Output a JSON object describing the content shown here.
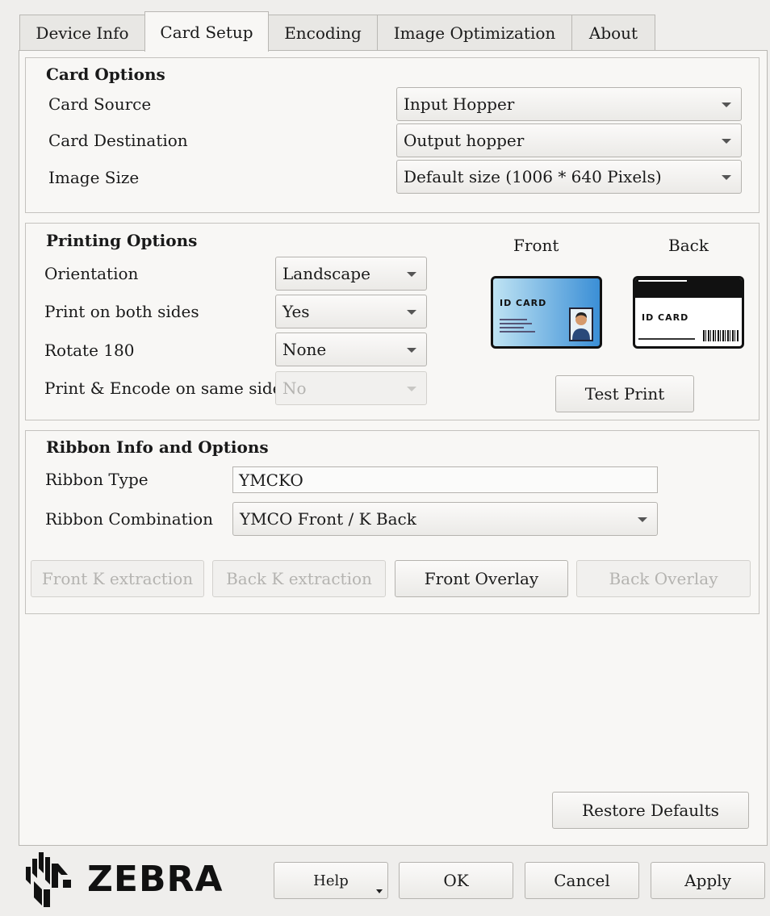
{
  "tabs": [
    {
      "label": "Device Info"
    },
    {
      "label": "Card Setup"
    },
    {
      "label": "Encoding"
    },
    {
      "label": "Image Optimization"
    },
    {
      "label": "About"
    }
  ],
  "card_options": {
    "title": "Card Options",
    "source_label": "Card Source",
    "source_value": "Input Hopper",
    "destination_label": "Card Destination",
    "destination_value": "Output hopper",
    "image_size_label": "Image Size",
    "image_size_value": "Default size (1006 * 640 Pixels)"
  },
  "printing_options": {
    "title": "Printing Options",
    "orientation_label": "Orientation",
    "orientation_value": "Landscape",
    "both_sides_label": "Print on both sides",
    "both_sides_value": "Yes",
    "rotate_label": "Rotate 180",
    "rotate_value": "None",
    "same_side_label": "Print & Encode on same side",
    "same_side_value": "No",
    "front_label": "Front",
    "back_label": "Back",
    "front_card_text": "ID CARD",
    "back_card_text": "ID CARD",
    "test_print_label": "Test Print"
  },
  "ribbon": {
    "title": "Ribbon Info and Options",
    "type_label": "Ribbon Type",
    "type_value": "YMCKO",
    "combination_label": "Ribbon Combination",
    "combination_value": "YMCO Front / K Back",
    "front_k_label": "Front K extraction",
    "back_k_label": "Back K extraction",
    "front_overlay_label": "Front Overlay",
    "back_overlay_label": "Back Overlay"
  },
  "restore_defaults_label": "Restore Defaults",
  "footer": {
    "brand": "ZEBRA",
    "help_label": "Help",
    "ok_label": "OK",
    "cancel_label": "Cancel",
    "apply_label": "Apply"
  },
  "colors": {
    "front_card_gradient_start": "#bfe3f3",
    "front_card_gradient_end": "#3b8fd6"
  }
}
